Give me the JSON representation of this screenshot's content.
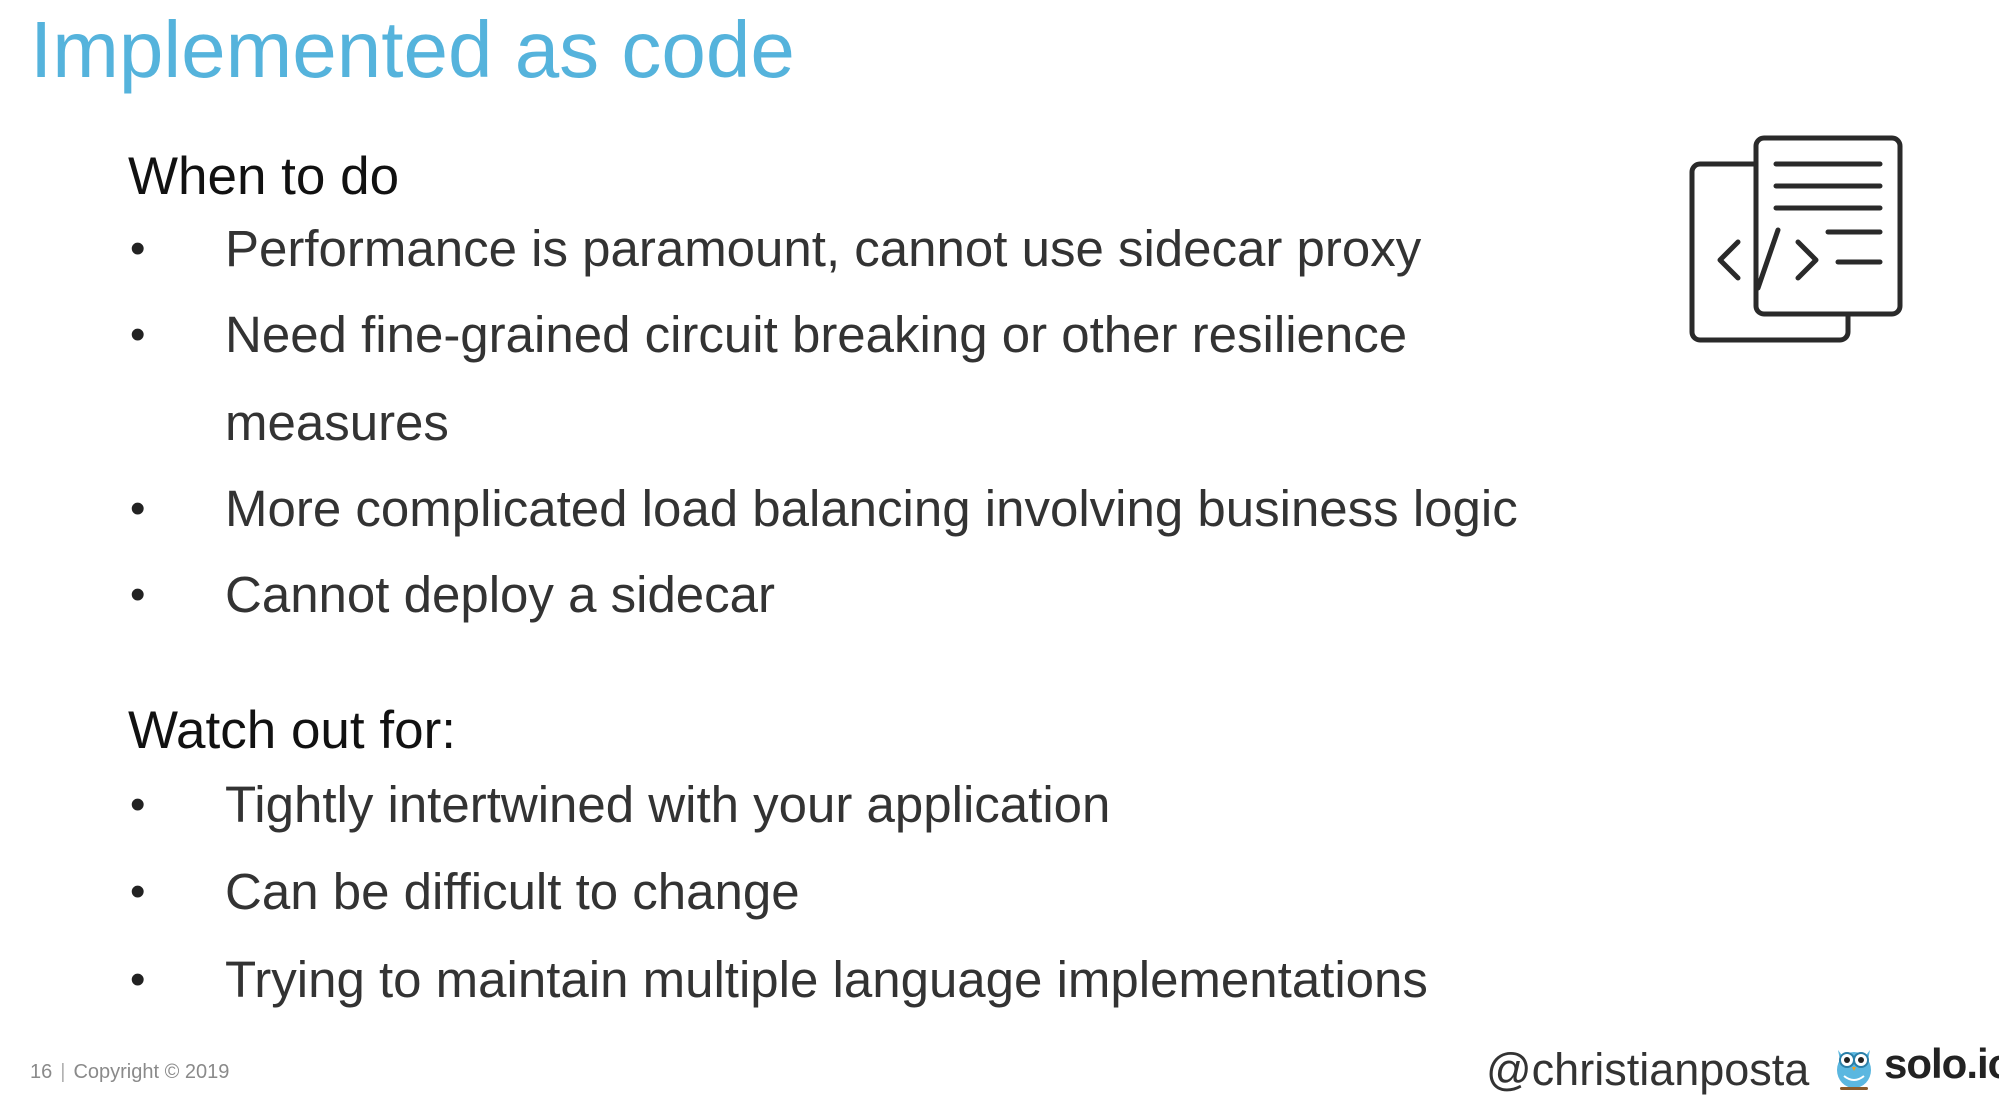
{
  "slide": {
    "title": "Implemented as code"
  },
  "when_section": {
    "heading": "When to do",
    "bullets": [
      "Performance is paramount, cannot use sidecar proxy",
      "Need fine-grained circuit breaking or other resilience measures",
      "More complicated load balancing involving business logic",
      "Cannot deploy a sidecar"
    ]
  },
  "watch_section": {
    "heading": "Watch out for:",
    "bullets": [
      "Tightly intertwined with your application",
      "Can be difficult to change",
      "Trying to maintain multiple language implementations"
    ]
  },
  "bullet_glyph": "•",
  "icon": {
    "name": "code-document-icon"
  },
  "footer": {
    "page_number": "16",
    "separator": "|",
    "copyright": "Copyright © 2019",
    "handle": "@christianposta",
    "logo_text": "solo.io"
  },
  "colors": {
    "title": "#55b3dc",
    "body_text": "#333333",
    "logo_owl": "#5bb7e0"
  }
}
